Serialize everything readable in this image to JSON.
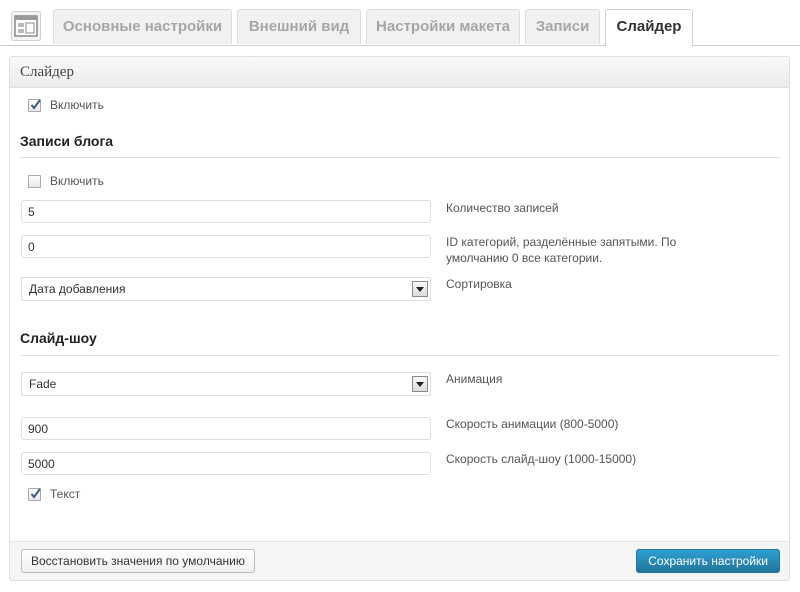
{
  "tabs": {
    "items": [
      {
        "label": "Основные настройки"
      },
      {
        "label": "Внешний вид"
      },
      {
        "label": "Настройки макета"
      },
      {
        "label": "Записи"
      },
      {
        "label": "Слайдер"
      }
    ],
    "active": "Слайдер",
    "icon": "layout-icon"
  },
  "panel": {
    "title": "Слайдер",
    "enable": {
      "label": "Включить",
      "checked": true
    },
    "blog_posts": {
      "title": "Записи блога",
      "enable": {
        "label": "Включить",
        "checked": false
      },
      "count": {
        "value": "5",
        "label": "Количество записей"
      },
      "category_ids": {
        "value": "0",
        "label": "ID категорий, разделённые запятыми. По умолчанию 0 все категории."
      },
      "sort": {
        "value": "Дата добавления",
        "label": "Сортировка"
      }
    },
    "slideshow": {
      "title": "Слайд-шоу",
      "animation": {
        "value": "Fade",
        "label": "Анимация"
      },
      "animation_speed": {
        "value": "900",
        "label": "Скорость анимации (800-5000)"
      },
      "slideshow_speed": {
        "value": "5000",
        "label": "Скорость слайд-шоу (1000-15000)"
      },
      "text": {
        "label": "Текст",
        "checked": true
      }
    }
  },
  "footer": {
    "reset_label": "Восстановить значения по умолчанию",
    "save_label": "Сохранить настройки"
  },
  "colors": {
    "accent": "#21759b",
    "header_bg": "#ececec",
    "border": "#dfdfdf"
  }
}
